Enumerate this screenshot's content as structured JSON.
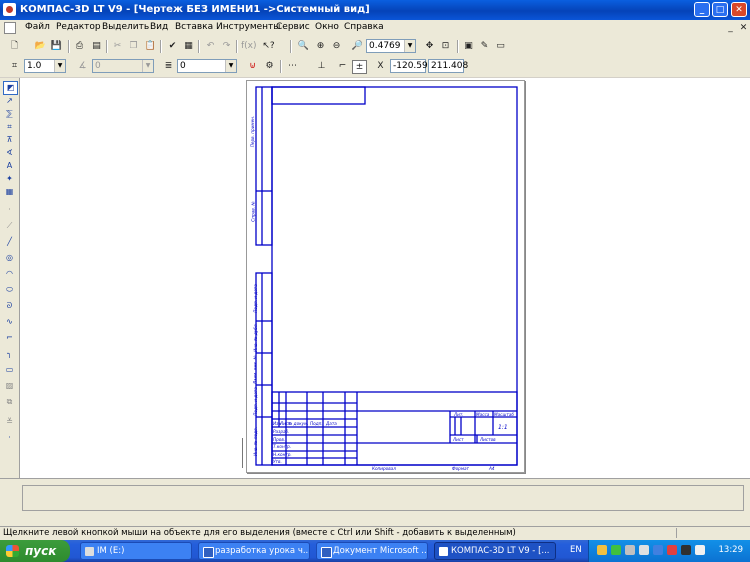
{
  "window": {
    "title": "КОМПАС-3D LT V9 - [Чертеж БЕЗ ИМЕНИ1 ->Системный вид]",
    "min": "_",
    "max": "□",
    "close": "✕"
  },
  "menu": [
    "Файл",
    "Редактор",
    "Выделить",
    "Вид",
    "Вставка",
    "Инструменты",
    "Сервис",
    "Окно",
    "Справка"
  ],
  "toolbar1": {
    "zoom": "0.4769"
  },
  "toolbar2": {
    "line_scale": "1.0",
    "layer": "0",
    "coord_x": "-120.59",
    "coord_y": "211.408"
  },
  "drawing": {
    "title_block": {
      "razrab": "Разраб.",
      "prov": "Пров.",
      "tkontr": "Т.контр.",
      "nkontr": "Н.контр.",
      "utv": "Утв.",
      "izm": "Изм",
      "list": "Лист",
      "ndokum": "№ докум.",
      "podp": "Подп.",
      "data": "Дата",
      "lit": "Лит.",
      "massa": "Масса",
      "masshtab": "Масштаб",
      "list_short": "Лист",
      "listov": "Листов",
      "scale_value": "1:1",
      "kopiroval": "Копировал",
      "format": "Формат",
      "format_value": "A4"
    },
    "side_stamp": [
      "Перв. примен.",
      "Справ. №",
      "Подп. и дата",
      "Инв. № дубл.",
      "Взам. инв. №",
      "Подп. и дата",
      "Инв. № подл."
    ]
  },
  "status": {
    "hint": "Щелкните левой кнопкой мыши на объекте для его выделения (вместе с Ctrl или Shift - добавить к выделенным)"
  },
  "taskbar": {
    "start": "пуск",
    "tasks": [
      "IM (E:)",
      "разработка урока ч...",
      "Документ Microsoft ...",
      "КОМПАС-3D LT V9 - [..."
    ],
    "lang": "EN",
    "clock": "13:29"
  },
  "colors": {
    "drawing_blue": "#0000c8",
    "titlebar": "#0a5fe0",
    "taskbar": "#245edb"
  }
}
